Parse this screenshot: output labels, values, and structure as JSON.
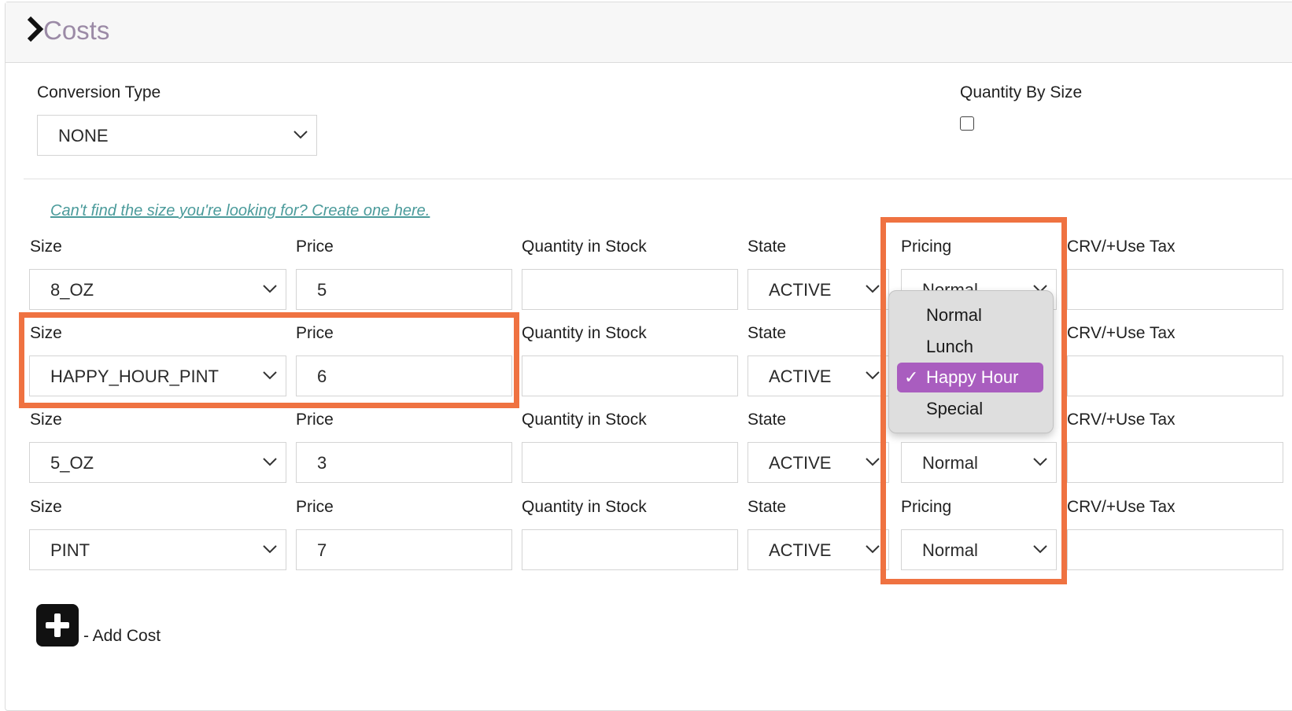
{
  "section": {
    "title": "Costs"
  },
  "conversion": {
    "label": "Conversion Type",
    "value": "NONE"
  },
  "quantity_by_size": {
    "label": "Quantity By Size",
    "checked": false
  },
  "create_link": "Can't find the size you're looking for? Create one here.",
  "headers": {
    "size": "Size",
    "price": "Price",
    "qty": "Quantity in Stock",
    "state": "State",
    "pricing": "Pricing",
    "crv": "CRV/+Use Tax"
  },
  "rows": [
    {
      "size": "8_OZ",
      "price": "5",
      "qty": "",
      "state": "ACTIVE",
      "pricing": "Normal",
      "crv": ""
    },
    {
      "size": "HAPPY_HOUR_PINT",
      "price": "6",
      "qty": "",
      "state": "ACTIVE",
      "pricing": "Happy Hour",
      "crv": ""
    },
    {
      "size": "5_OZ",
      "price": "3",
      "qty": "",
      "state": "ACTIVE",
      "pricing": "Normal",
      "crv": ""
    },
    {
      "size": "PINT",
      "price": "7",
      "qty": "",
      "state": "ACTIVE",
      "pricing": "Normal",
      "crv": ""
    }
  ],
  "pricing_dropdown": {
    "options": [
      "Normal",
      "Lunch",
      "Happy Hour",
      "Special"
    ],
    "selected": "Happy Hour"
  },
  "add_cost": {
    "label": "- Add Cost"
  },
  "colors": {
    "highlight": "#ef7241",
    "selected_option": "#a95dbf",
    "title": "#9b8aa6",
    "link": "#4b9b9b"
  }
}
